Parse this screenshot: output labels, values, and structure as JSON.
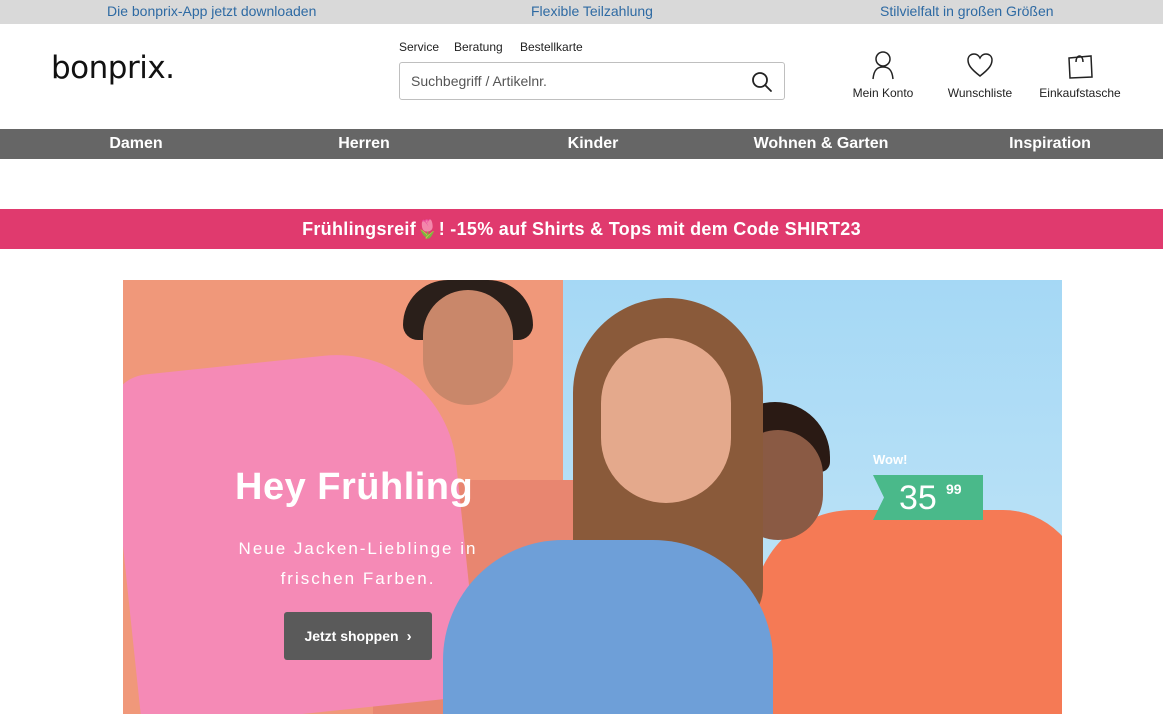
{
  "topbar": {
    "app": "Die bonprix-App jetzt downloaden",
    "installment": "Flexible Teilzahlung",
    "variety": "Stilvielfalt in großen Größen"
  },
  "header": {
    "logo": "bonprix.",
    "links": {
      "service": "Service",
      "beratung": "Beratung",
      "bestellkarte": "Bestellkarte"
    },
    "search": {
      "placeholder": "Suchbegriff / Artikelnr."
    },
    "account": "Mein Konto",
    "wishlist": "Wunschliste",
    "bag": "Einkaufstasche"
  },
  "nav": {
    "items": [
      "Damen",
      "Herren",
      "Kinder",
      "Wohnen & Garten",
      "Inspiration"
    ]
  },
  "promo": {
    "text": "Frühlingsreif🌷! -15% auf Shirts & Tops mit dem Code SHIRT23"
  },
  "hero": {
    "title": "Hey Frühling",
    "subtitle": "Neue Jacken-Lieblinge in frischen Farben.",
    "cta": "Jetzt shoppen",
    "badge": "Wow!",
    "price_int": "35",
    "price_dec": "99"
  },
  "colors": {
    "promo": "#e03a6e",
    "nav": "#666666",
    "link": "#2e6aa3",
    "price_tag": "#4ab98a"
  }
}
